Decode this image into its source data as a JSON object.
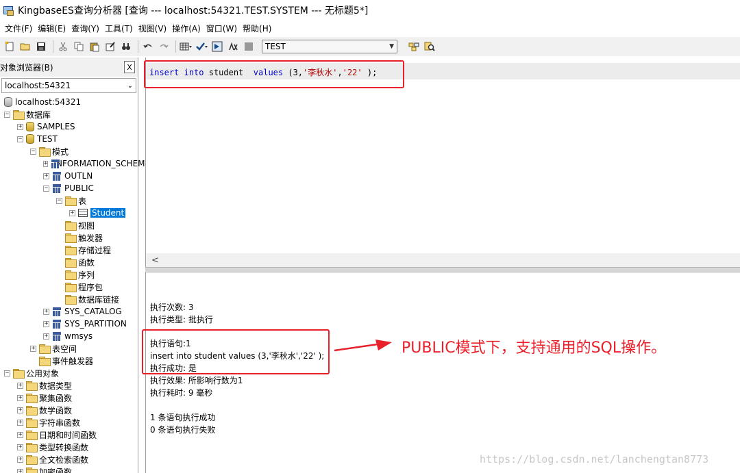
{
  "window": {
    "title": "KingbaseES查询分析器  [查询  ---  localhost:54321.TEST.SYSTEM  ---  无标题5*]"
  },
  "menu": [
    "文件(F)",
    "编辑(E)",
    "查询(Y)",
    "工具(T)",
    "视图(V)",
    "操作(A)",
    "窗口(W)",
    "帮助(H)"
  ],
  "toolbar": {
    "database_select": "TEST",
    "icons": [
      "new-file-icon",
      "open-folder-icon",
      "save-icon",
      "cut-icon",
      "copy-icon",
      "paste-icon",
      "edit-icon",
      "find-icon",
      "undo-icon",
      "redo-icon",
      "grid-icon",
      "check-icon",
      "execute-icon",
      "explain-icon",
      "stop-icon",
      "object-browser-icon",
      "search-object-icon"
    ]
  },
  "browser": {
    "caption": "对象浏览器(B)",
    "close": "X",
    "server": "localhost:54321",
    "tree": [
      {
        "label": "localhost:54321",
        "level": 0,
        "icon": "server",
        "exp": ""
      },
      {
        "label": "数据库",
        "level": 0,
        "icon": "folder",
        "exp": "-"
      },
      {
        "label": "SAMPLES",
        "level": 1,
        "icon": "db",
        "exp": "+"
      },
      {
        "label": "TEST",
        "level": 1,
        "icon": "db",
        "exp": "-"
      },
      {
        "label": "模式",
        "level": 2,
        "icon": "folder",
        "exp": "-"
      },
      {
        "label": "INFORMATION_SCHEMA",
        "level": 3,
        "icon": "schema",
        "exp": "+"
      },
      {
        "label": "OUTLN",
        "level": 3,
        "icon": "schema",
        "exp": "+"
      },
      {
        "label": "PUBLIC",
        "level": 3,
        "icon": "schema",
        "exp": "-"
      },
      {
        "label": "表",
        "level": 4,
        "icon": "folder",
        "exp": "-"
      },
      {
        "label": "Student",
        "level": 5,
        "icon": "table",
        "exp": "+",
        "selected": true
      },
      {
        "label": "视图",
        "level": 4,
        "icon": "folder",
        "exp": ""
      },
      {
        "label": "触发器",
        "level": 4,
        "icon": "folder",
        "exp": ""
      },
      {
        "label": "存储过程",
        "level": 4,
        "icon": "folder",
        "exp": ""
      },
      {
        "label": "函数",
        "level": 4,
        "icon": "folder",
        "exp": ""
      },
      {
        "label": "序列",
        "level": 4,
        "icon": "folder",
        "exp": ""
      },
      {
        "label": "程序包",
        "level": 4,
        "icon": "folder",
        "exp": ""
      },
      {
        "label": "数据库链接",
        "level": 4,
        "icon": "folder",
        "exp": ""
      },
      {
        "label": "SYS_CATALOG",
        "level": 3,
        "icon": "schema",
        "exp": "+"
      },
      {
        "label": "SYS_PARTITION",
        "level": 3,
        "icon": "schema",
        "exp": "+"
      },
      {
        "label": "wmsys",
        "level": 3,
        "icon": "schema",
        "exp": "+"
      },
      {
        "label": "表空间",
        "level": 2,
        "icon": "folder",
        "exp": "+"
      },
      {
        "label": "事件触发器",
        "level": 2,
        "icon": "folder",
        "exp": ""
      },
      {
        "label": "公用对象",
        "level": 0,
        "icon": "folder",
        "exp": "-"
      },
      {
        "label": "数据类型",
        "level": 1,
        "icon": "folder",
        "exp": "+"
      },
      {
        "label": "聚集函数",
        "level": 1,
        "icon": "folder",
        "exp": "+"
      },
      {
        "label": "数学函数",
        "level": 1,
        "icon": "folder",
        "exp": "+"
      },
      {
        "label": "字符串函数",
        "level": 1,
        "icon": "folder",
        "exp": "+"
      },
      {
        "label": "日期和时间函数",
        "level": 1,
        "icon": "folder",
        "exp": "+"
      },
      {
        "label": "类型转换函数",
        "level": 1,
        "icon": "folder",
        "exp": "+"
      },
      {
        "label": "全文检索函数",
        "level": 1,
        "icon": "folder",
        "exp": "+"
      },
      {
        "label": "加密函数",
        "level": 1,
        "icon": "folder",
        "exp": "+"
      }
    ]
  },
  "editor": {
    "kw_insert": "insert",
    "kw_into": "into",
    "table": "student",
    "kw_values": "values",
    "open": "(3,",
    "str1": "'李秋水'",
    "comma": ",",
    "str2": "'22'",
    "close": " );",
    "scroll_left": "<"
  },
  "results": {
    "lines": [
      "执行次数: 3",
      "执行类型: 批执行",
      "执行语句:1",
      "insert into student  values (3,'李秋水','22' );",
      "执行成功: 是",
      "执行效果: 所影响行数为1",
      "执行耗时: 9 毫秒",
      "1 条语句执行成功",
      "0 条语句执行失败"
    ]
  },
  "annotation": {
    "text": "PUBLIC模式下，支持通用的SQL操作。",
    "color": "#e8202a"
  },
  "watermark": "https://blog.csdn.net/lanchengtan8773"
}
